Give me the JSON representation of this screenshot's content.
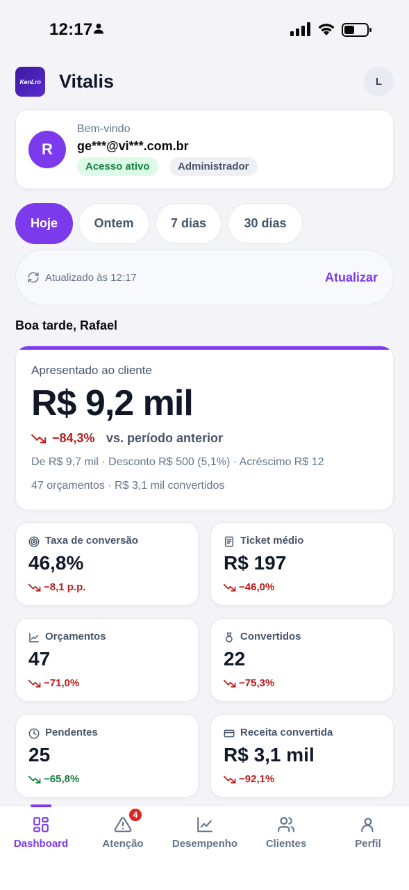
{
  "status_bar": {
    "time": "12:17"
  },
  "header": {
    "logo_text": "KenLro",
    "title": "Vitalis",
    "user_initial": "L"
  },
  "welcome": {
    "avatar_initial": "R",
    "label": "Bem-vindo",
    "email": "ge***@vi***.com.br",
    "badges": [
      "Acesso ativo",
      "Administrador"
    ]
  },
  "periods": [
    {
      "label": "Hoje",
      "active": true
    },
    {
      "label": "Ontem",
      "active": false
    },
    {
      "label": "7 dias",
      "active": false
    },
    {
      "label": "30 dias",
      "active": false
    }
  ],
  "update_bar": {
    "text": "Atualizado às 12:17",
    "button": "Atualizar"
  },
  "greeting": "Boa tarde, Rafael",
  "main_kpi": {
    "label": "Apresentado ao cliente",
    "value": "R$ 9,2 mil",
    "change": "−84,3%",
    "change_suffix": "vs. período anterior",
    "detail": "De R$ 9,7 mil · Desconto R$ 500 (5,1%) · Acréscimo R$ 12",
    "detail2": "47 orçamentos · R$ 3,1 mil convertidos"
  },
  "metrics": [
    {
      "label": "Taxa de conversão",
      "value": "46,8%",
      "change": "−8,1 p.p.",
      "icon": "target-icon",
      "change_color": "#b91c1c"
    },
    {
      "label": "Ticket médio",
      "value": "R$ 197",
      "change": "−46,0%",
      "icon": "receipt-icon",
      "change_color": "#b91c1c"
    },
    {
      "label": "Orçamentos",
      "value": "47",
      "change": "−71,0%",
      "icon": "line-chart-icon",
      "change_color": "#b91c1c"
    },
    {
      "label": "Convertidos",
      "value": "22",
      "change": "−75,3%",
      "icon": "medal-icon",
      "change_color": "#b91c1c"
    },
    {
      "label": "Pendentes",
      "value": "25",
      "change": "−65,8%",
      "icon": "clock-icon",
      "change_color": "#15803d"
    },
    {
      "label": "Receita convertida",
      "value": "R$ 3,1 mil",
      "change": "−92,1%",
      "icon": "wallet-icon",
      "change_color": "#b91c1c"
    }
  ],
  "bottom_nav": [
    {
      "label": "Dashboard",
      "icon": "dashboard-icon",
      "active": true
    },
    {
      "label": "Atenção",
      "icon": "alert-icon",
      "badge": "4"
    },
    {
      "label": "Desempenho",
      "icon": "chart-icon"
    },
    {
      "label": "Clientes",
      "icon": "users-icon"
    },
    {
      "label": "Perfil",
      "icon": "profile-icon"
    }
  ],
  "colors": {
    "accent": "#7c3aed",
    "negative": "#b91c1c",
    "positive": "#15803d"
  }
}
